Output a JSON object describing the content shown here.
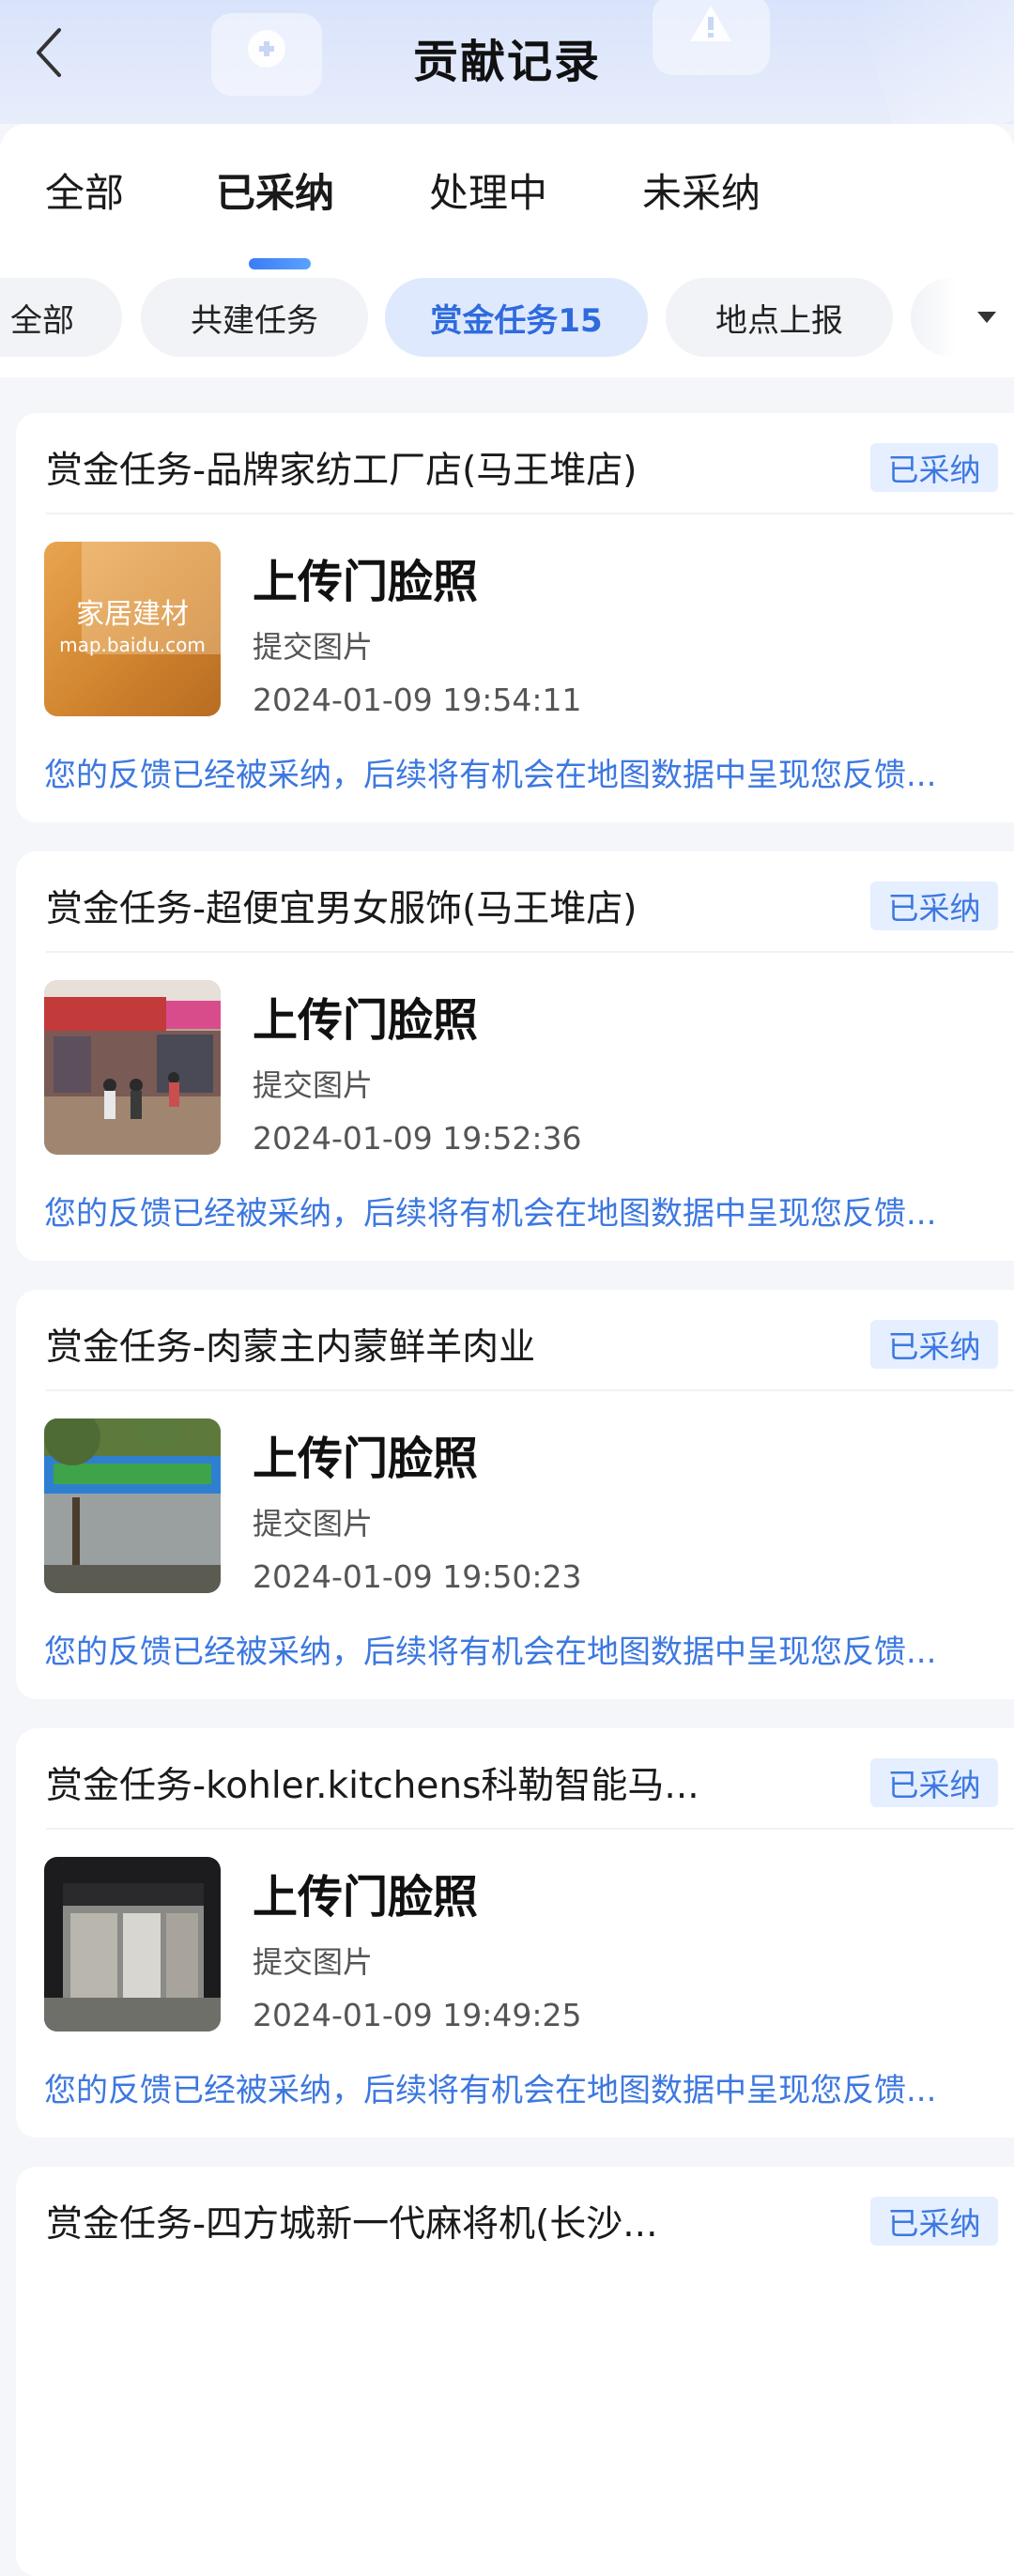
{
  "header": {
    "title": "贡献记录"
  },
  "tabs": [
    {
      "label": "全部"
    },
    {
      "label": "已采纳"
    },
    {
      "label": "处理中"
    },
    {
      "label": "未采纳"
    }
  ],
  "chips": [
    {
      "label": "全部"
    },
    {
      "label": "共建任务"
    },
    {
      "label": "赏金任务15"
    },
    {
      "label": "地点上报"
    }
  ],
  "cards": [
    {
      "title": "赏金任务-品牌家纺工厂店(马王堆店)",
      "status": "已采纳",
      "task": "上传门脸照",
      "type": "提交图片",
      "time": "2024-01-09 19:54:11",
      "feedback": "您的反馈已经被采纳，后续将有机会在地图数据中呈现您反馈...",
      "thumb_text": "家居建材",
      "thumb_subtext": "map.baidu.com"
    },
    {
      "title": "赏金任务-超便宜男女服饰(马王堆店)",
      "status": "已采纳",
      "task": "上传门脸照",
      "type": "提交图片",
      "time": "2024-01-09 19:52:36",
      "feedback": "您的反馈已经被采纳，后续将有机会在地图数据中呈现您反馈..."
    },
    {
      "title": "赏金任务-肉蒙主内蒙鲜羊肉业",
      "status": "已采纳",
      "task": "上传门脸照",
      "type": "提交图片",
      "time": "2024-01-09 19:50:23",
      "feedback": "您的反馈已经被采纳，后续将有机会在地图数据中呈现您反馈..."
    },
    {
      "title": "赏金任务-kohler.kitchens科勒智能马...",
      "status": "已采纳",
      "task": "上传门脸照",
      "type": "提交图片",
      "time": "2024-01-09 19:49:25",
      "feedback": "您的反馈已经被采纳，后续将有机会在地图数据中呈现您反馈..."
    },
    {
      "title": "赏金任务-四方城新一代麻将机(长沙...",
      "status": "已采纳"
    }
  ]
}
